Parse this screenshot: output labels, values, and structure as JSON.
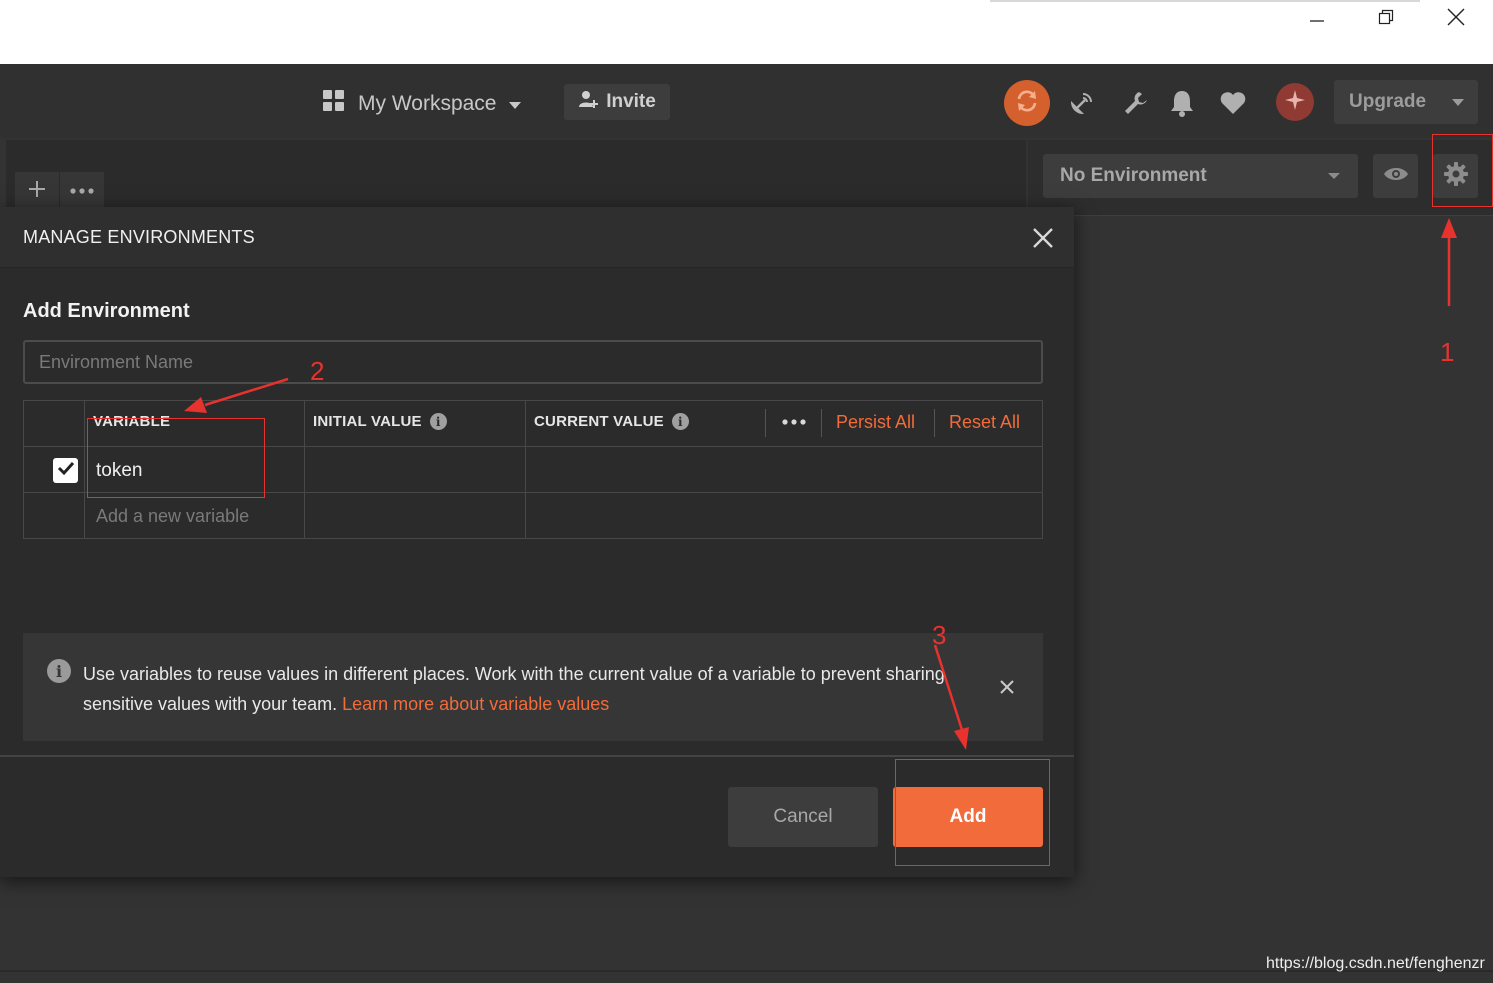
{
  "header": {
    "workspace_label": "My Workspace",
    "invite_label": "Invite",
    "upgrade_label": "Upgrade"
  },
  "environment_bar": {
    "selected_environment": "No Environment"
  },
  "modal": {
    "title": "MANAGE ENVIRONMENTS",
    "section_title": "Add Environment",
    "name_placeholder": "Environment Name",
    "table": {
      "columns": [
        "VARIABLE",
        "INITIAL VALUE",
        "CURRENT VALUE"
      ],
      "persist_all": "Persist All",
      "reset_all": "Reset All",
      "rows": [
        {
          "checked": true,
          "variable": "token",
          "initial_value": "",
          "current_value": ""
        }
      ],
      "new_variable_placeholder": "Add a new variable"
    },
    "banner": {
      "text": "Use variables to reuse values in different places. Work with the current value of a variable to prevent sharing sensitive values with your team.",
      "link": "Learn more about variable values"
    },
    "cancel_label": "Cancel",
    "add_label": "Add"
  },
  "annotations": {
    "step1": "1",
    "step2": "2",
    "step3": "3"
  },
  "watermark": "https://blog.csdn.net/fenghenzr",
  "colors": {
    "accent": "#f26b3a",
    "annotation": "#e8322e",
    "background": "#333333"
  },
  "icons": [
    "minimize-icon",
    "restore-icon",
    "window-close-icon",
    "grid-icon",
    "chevron-down-icon",
    "add-user-icon",
    "sync-icon",
    "satellite-icon",
    "wrench-icon",
    "bell-icon",
    "heart-icon",
    "sparkle-icon",
    "plus-icon",
    "more-icon",
    "eye-icon",
    "gear-icon",
    "close-icon",
    "check-icon",
    "info-icon"
  ]
}
